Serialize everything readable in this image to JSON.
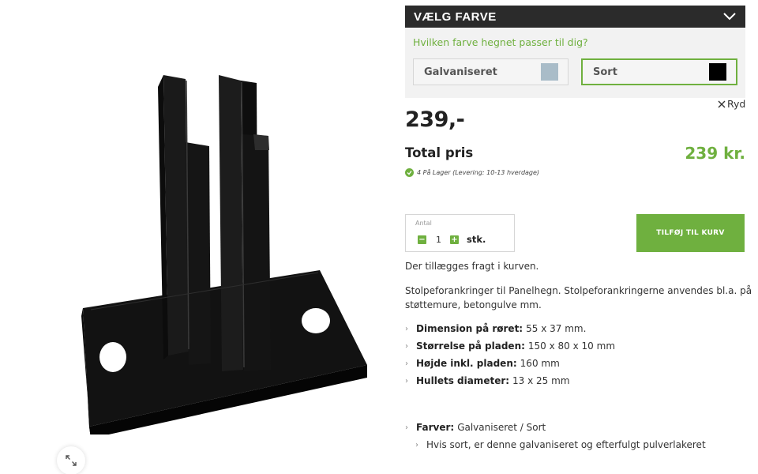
{
  "color_selector": {
    "title": "VÆLG FARVE",
    "question": "Hvilken farve hegnet passer til dig?",
    "options": [
      {
        "label": "Galvaniseret",
        "color": "#a9bcc8",
        "selected": false
      },
      {
        "label": "Sort",
        "color": "#000000",
        "selected": true
      }
    ],
    "clear_label": "Ryd"
  },
  "price": "239,-",
  "total": {
    "label": "Total pris",
    "value": "239 kr."
  },
  "stock": "4 På Lager (Levering: 10-13 hverdage)",
  "quantity": {
    "label": "Antal",
    "value": "1",
    "unit": "stk."
  },
  "add_to_cart": "TILFØJ TIL KURV",
  "freight_note": "Der tillægges fragt i kurven.",
  "description": "Stolpeforankringer til Panelhegn. Stolpeforankringerne anvendes bl.a. på støttemure, betongulve mm.",
  "specs": [
    {
      "label": "Dimension på røret:",
      "value": "55 x 37 mm."
    },
    {
      "label": "Størrelse på pladen:",
      "value": "150 x 80 x 10 mm"
    },
    {
      "label": "Højde inkl. pladen:",
      "value": "160 mm"
    },
    {
      "label": "Hullets diameter:",
      "value": "13 x 25 mm"
    }
  ],
  "colors_info": {
    "label": "Farver:",
    "value": "Galvaniseret / Sort",
    "sub": "Hvis sort, er denne galvaniseret og efterfulgt pulverlakeret"
  },
  "accent_color": "#6fb03f"
}
